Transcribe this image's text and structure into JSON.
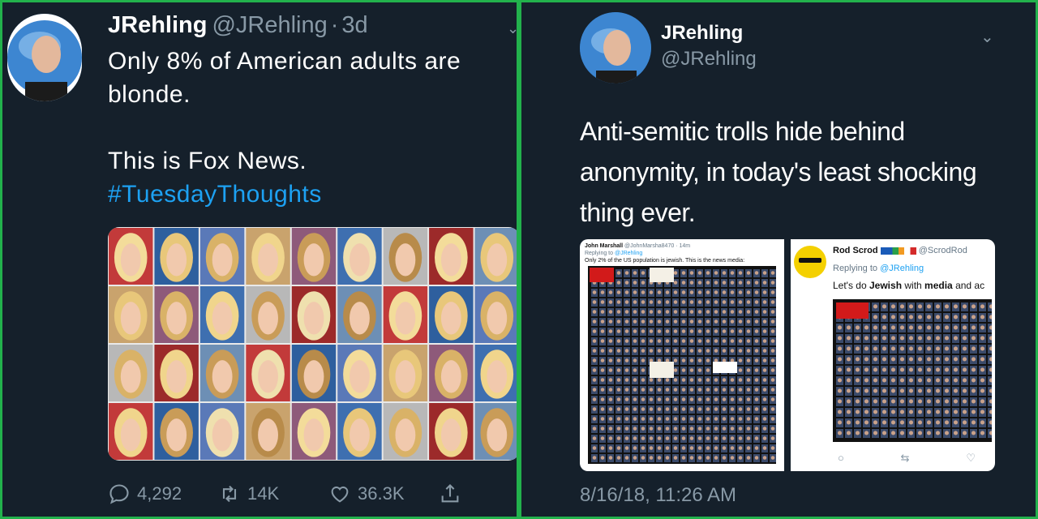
{
  "left_tweet": {
    "name": "JRehling",
    "handle": "@JRehling",
    "separator": "·",
    "age": "3d",
    "text_line1": "Only 8% of American adults are blonde.",
    "text_line2": "This is Fox News.",
    "hashtag": "#TuesdayThoughts",
    "actions": {
      "replies": "4,292",
      "retweets": "14K",
      "likes": "36.3K"
    }
  },
  "right_tweet": {
    "name": "JRehling",
    "handle": "@JRehling",
    "text": "Anti-semitic trolls hide behind anonymity, in today's least shocking thing ever.",
    "timestamp": "8/16/18, 11:26 AM",
    "media1": {
      "name": "John Marshall",
      "handle": "@JohnMarsha8470",
      "age": "14m",
      "replying_prefix": "Replying to",
      "replying_to": "@JRehling",
      "text": "Only 2% of the US population is jewish. This is the news media:",
      "logos": [
        "CNN",
        "New York Times",
        "CBS NEWS",
        "npr"
      ]
    },
    "media2": {
      "name": "Rod Scrod",
      "handle": "@ScrodRod",
      "replying_prefix": "Replying to",
      "replying_to": "@JRehling",
      "text_a": "Let's do ",
      "text_b": "Jewish",
      "text_c": " with ",
      "text_d": "media",
      "text_e": " and ac",
      "logo": "CNN"
    }
  },
  "colors": {
    "background": "#15202b",
    "divider": "#22b14c",
    "secondary_text": "#8899a6",
    "link": "#1da1f2"
  }
}
